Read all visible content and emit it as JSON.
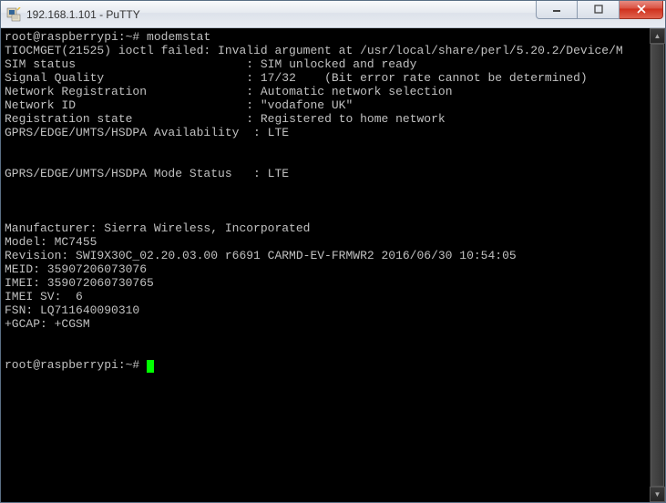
{
  "window": {
    "title": "192.168.1.101 - PuTTY",
    "app_name": "PuTTY"
  },
  "terminal": {
    "prompt": "root@raspberrypi:~#",
    "command": "modemstat",
    "lines": {
      "error": "TIOCMGET(21525) ioctl failed: Invalid argument at /usr/local/share/perl/5.20.2/Device/M",
      "sim_status_label": "SIM status",
      "sim_status_value": "SIM unlocked and ready",
      "signal_quality_label": "Signal Quality",
      "signal_quality_value": "17/32    (Bit error rate cannot be determined)",
      "network_reg_label": "Network Registration",
      "network_reg_value": "Automatic network selection",
      "network_id_label": "Network ID",
      "network_id_value": "\"vodafone UK\"",
      "reg_state_label": "Registration state",
      "reg_state_value": "Registered to home network",
      "avail_label": "GPRS/EDGE/UMTS/HSDPA Availability",
      "avail_value": "LTE",
      "mode_label": "GPRS/EDGE/UMTS/HSDPA Mode Status",
      "mode_value": "LTE",
      "manufacturer": "Manufacturer: Sierra Wireless, Incorporated",
      "model": "Model: MC7455",
      "revision": "Revision: SWI9X30C_02.20.03.00 r6691 CARMD-EV-FRMWR2 2016/06/30 10:54:05",
      "meid": "MEID: 35907206073076",
      "imei": "IMEI: 359072060730765",
      "imei_sv": "IMEI SV:  6",
      "fsn": "FSN: LQ711640090310",
      "gcap": "+GCAP: +CGSM"
    }
  }
}
